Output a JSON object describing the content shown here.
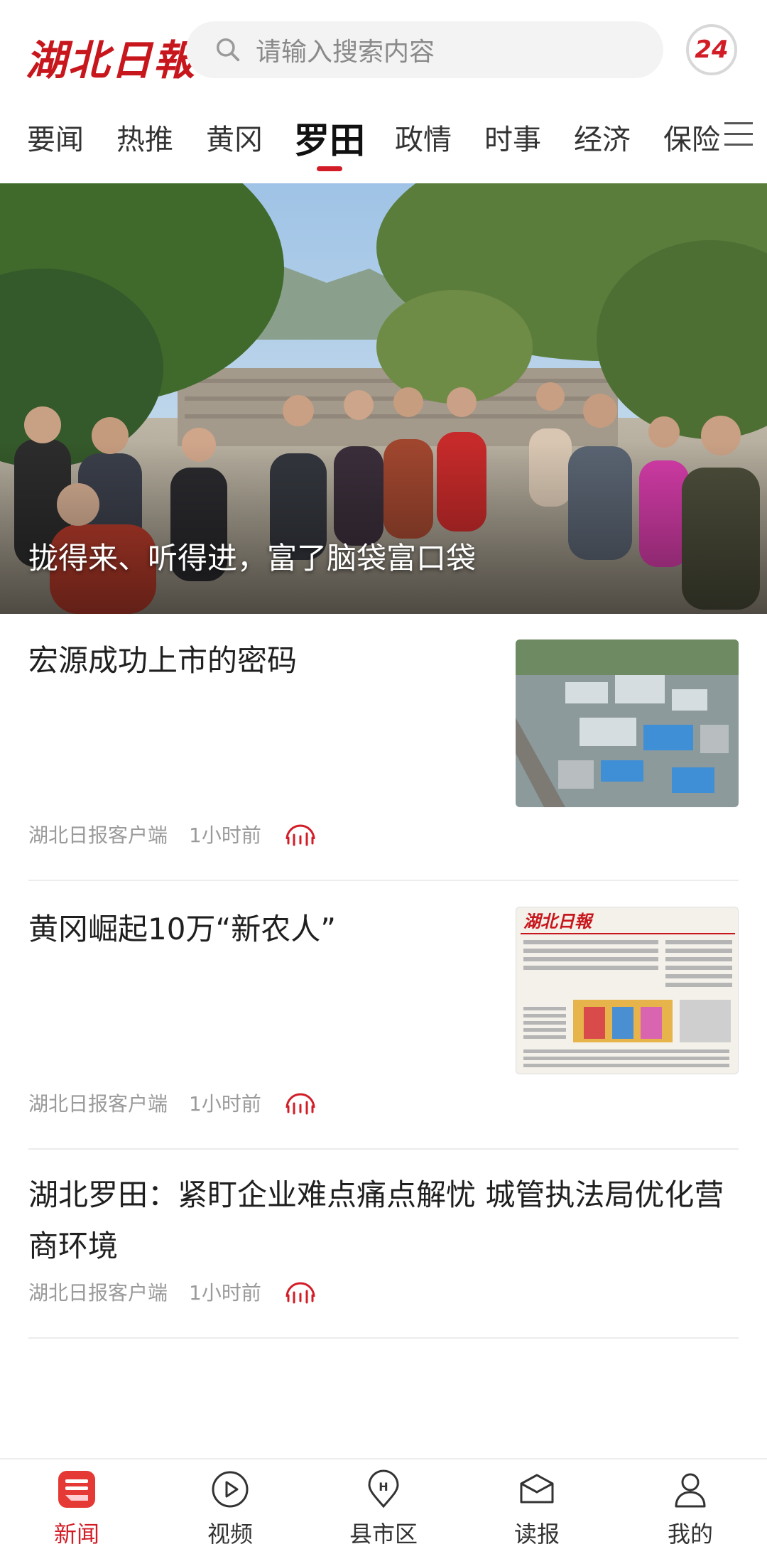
{
  "header": {
    "logo_text": "湖北日報",
    "search_placeholder": "请输入搜索内容",
    "badge_text": "24"
  },
  "tabs": [
    {
      "label": "要闻"
    },
    {
      "label": "热推"
    },
    {
      "label": "黄冈"
    },
    {
      "label": "罗田",
      "active": true
    },
    {
      "label": "政情"
    },
    {
      "label": "时事"
    },
    {
      "label": "经济"
    },
    {
      "label": "保险"
    }
  ],
  "hero": {
    "caption": "拢得来、听得进，富了脑袋富口袋"
  },
  "articles": [
    {
      "title": "宏源成功上市的密码",
      "source": "湖北日报客户端",
      "time": "1小时前",
      "thumb": "industrial-aerial-photo"
    },
    {
      "title": "黄冈崛起10万“新农人”",
      "source": "湖北日报客户端",
      "time": "1小时前",
      "thumb": "newspaper-page-photo"
    },
    {
      "title": "湖北罗田：紧盯企业难点痛点解忧 城管执法局优化营商环境",
      "source": "湖北日报客户端",
      "time": "1小时前"
    }
  ],
  "bottom_nav": [
    {
      "label": "新闻",
      "icon": "news-icon",
      "active": true
    },
    {
      "label": "视频",
      "icon": "video-play-icon"
    },
    {
      "label": "县市区",
      "icon": "location-pin-icon"
    },
    {
      "label": "读报",
      "icon": "read-paper-icon"
    },
    {
      "label": "我的",
      "icon": "user-icon"
    }
  ],
  "colors": {
    "brand_red": "#d21d27",
    "text": "#1f1f1f",
    "meta": "#9a9a9a"
  }
}
